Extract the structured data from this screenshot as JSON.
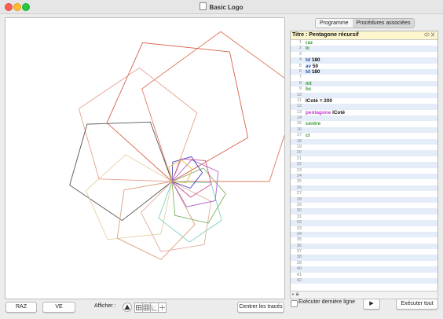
{
  "window": {
    "title": "Basic Logo"
  },
  "tabs": [
    {
      "label": "Programme",
      "selected": false
    },
    {
      "label": "Procédures associées",
      "selected": true
    }
  ],
  "editor": {
    "header": "Titre : Pentagone récursif",
    "lines": [
      {
        "n": "1",
        "tokens": [
          {
            "t": "raz",
            "c": "green"
          }
        ]
      },
      {
        "n": "2",
        "tokens": [
          {
            "t": "lc",
            "c": "green"
          }
        ]
      },
      {
        "n": "3",
        "tokens": []
      },
      {
        "n": "4",
        "tokens": [
          {
            "t": "td ",
            "c": "blue"
          },
          {
            "t": "180",
            "c": "black"
          }
        ]
      },
      {
        "n": "5",
        "tokens": [
          {
            "t": "av ",
            "c": "blue"
          },
          {
            "t": "50",
            "c": "black"
          }
        ]
      },
      {
        "n": "6",
        "tokens": [
          {
            "t": "td ",
            "c": "blue"
          },
          {
            "t": "180",
            "c": "black"
          }
        ]
      },
      {
        "n": "7",
        "tokens": []
      },
      {
        "n": "8",
        "tokens": [
          {
            "t": "mt",
            "c": "green"
          }
        ]
      },
      {
        "n": "9",
        "tokens": [
          {
            "t": "bc",
            "c": "green"
          }
        ]
      },
      {
        "n": "10",
        "tokens": []
      },
      {
        "n": "11",
        "tokens": [
          {
            "t": "lCoté = 200",
            "c": "black"
          }
        ]
      },
      {
        "n": "12",
        "tokens": []
      },
      {
        "n": "13",
        "tokens": [
          {
            "t": "pentagone ",
            "c": "magenta"
          },
          {
            "t": "lCoté",
            "c": "black"
          }
        ]
      },
      {
        "n": "14",
        "tokens": []
      },
      {
        "n": "15",
        "tokens": [
          {
            "t": "centre",
            "c": "green"
          }
        ]
      },
      {
        "n": "16",
        "tokens": []
      },
      {
        "n": "17",
        "tokens": [
          {
            "t": "ct",
            "c": "green"
          }
        ]
      },
      {
        "n": "18",
        "tokens": []
      },
      {
        "n": "19",
        "tokens": []
      },
      {
        "n": "20",
        "tokens": []
      },
      {
        "n": "21",
        "tokens": []
      },
      {
        "n": "22",
        "tokens": []
      },
      {
        "n": "23",
        "tokens": []
      },
      {
        "n": "24",
        "tokens": []
      },
      {
        "n": "25",
        "tokens": []
      },
      {
        "n": "26",
        "tokens": []
      },
      {
        "n": "27",
        "tokens": []
      },
      {
        "n": "28",
        "tokens": []
      },
      {
        "n": "29",
        "tokens": []
      },
      {
        "n": "30",
        "tokens": []
      },
      {
        "n": "31",
        "tokens": []
      },
      {
        "n": "32",
        "tokens": []
      },
      {
        "n": "33",
        "tokens": []
      },
      {
        "n": "34",
        "tokens": []
      },
      {
        "n": "35",
        "tokens": []
      },
      {
        "n": "36",
        "tokens": []
      },
      {
        "n": "37",
        "tokens": []
      },
      {
        "n": "38",
        "tokens": []
      },
      {
        "n": "39",
        "tokens": []
      },
      {
        "n": "40",
        "tokens": []
      },
      {
        "n": "41",
        "tokens": []
      },
      {
        "n": "42",
        "tokens": []
      }
    ],
    "footer_letter": "a"
  },
  "bottom": {
    "raz": "RAZ",
    "ve": "VE",
    "afficher": "Afficher :",
    "centrer": "Centrer les tracés",
    "executer_derniere": "Exécuter dernière ligne",
    "run_icon": "▶",
    "executer_tout": "Exécuter tout"
  },
  "colors": {
    "green": "#3a9a3a",
    "blue": "#2a4fb0",
    "magenta": "#c23cd0",
    "black": "#111111"
  },
  "drawing": {
    "pentagons": [
      {
        "size": 200,
        "rotation": 0,
        "color": "#e07a60"
      },
      {
        "size": 180,
        "rotation": 30,
        "color": "#d9604a"
      },
      {
        "size": 150,
        "rotation": 70,
        "color": "#e8a090"
      },
      {
        "size": 130,
        "rotation": 110,
        "color": "#555555"
      },
      {
        "size": 110,
        "rotation": 150,
        "color": "#e6cfa0"
      },
      {
        "size": 100,
        "rotation": 190,
        "color": "#d9a080"
      },
      {
        "size": 90,
        "rotation": 225,
        "color": "#e0b0a0"
      },
      {
        "size": 80,
        "rotation": 250,
        "color": "#80d0c0"
      },
      {
        "size": 70,
        "rotation": 275,
        "color": "#80b060"
      },
      {
        "size": 60,
        "rotation": 300,
        "color": "#b060d0"
      },
      {
        "size": 50,
        "rotation": 320,
        "color": "#d05090"
      },
      {
        "size": 40,
        "rotation": 340,
        "color": "#4040c0"
      },
      {
        "size": 30,
        "rotation": 355,
        "color": "#e0c040"
      }
    ]
  }
}
